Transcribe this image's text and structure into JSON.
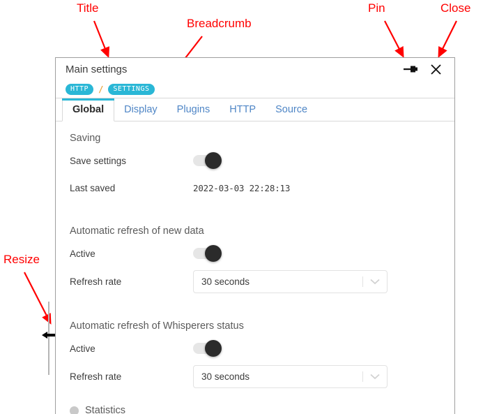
{
  "annotations": [
    {
      "id": "title",
      "label": "Title"
    },
    {
      "id": "breadcrumb",
      "label": "Breadcrumb"
    },
    {
      "id": "pin",
      "label": "Pin"
    },
    {
      "id": "close",
      "label": "Close"
    },
    {
      "id": "resize",
      "label": "Resize"
    }
  ],
  "panel": {
    "title": "Main settings",
    "titlebar_actions": [
      {
        "name": "pin-icon",
        "label": "Pin"
      },
      {
        "name": "close-icon",
        "label": "Close"
      }
    ],
    "breadcrumb": {
      "items": [
        "HTTP",
        "SETTINGS"
      ],
      "separator": "/"
    },
    "tabs": [
      {
        "label": "Global",
        "active": true
      },
      {
        "label": "Display",
        "active": false
      },
      {
        "label": "Plugins",
        "active": false
      },
      {
        "label": "HTTP",
        "active": false
      },
      {
        "label": "Source",
        "active": false
      }
    ],
    "sections": {
      "saving": {
        "title": "Saving",
        "save_settings_label": "Save settings",
        "save_settings_state": "on",
        "last_saved_label": "Last saved",
        "last_saved_value": "2022-03-03 22:28:13"
      },
      "refresh_new_data": {
        "title": "Automatic refresh of new data",
        "active_label": "Active",
        "active_state": "on",
        "refresh_rate_label": "Refresh rate",
        "refresh_rate_value": "30 seconds"
      },
      "refresh_whisperers": {
        "title": "Automatic refresh of Whisperers status",
        "active_label": "Active",
        "active_state": "on",
        "refresh_rate_label": "Refresh rate",
        "refresh_rate_value": "30 seconds"
      },
      "statistics": {
        "label": "Statistics"
      }
    }
  },
  "colors": {
    "accent": "#2ab7d6",
    "annotation": "#ff0000",
    "tab_inactive": "#4f86c6",
    "breadcrumb_separator": "#e8a33d",
    "toggle_knob": "#2b2b2b",
    "toggle_track": "#e6e6e6"
  }
}
